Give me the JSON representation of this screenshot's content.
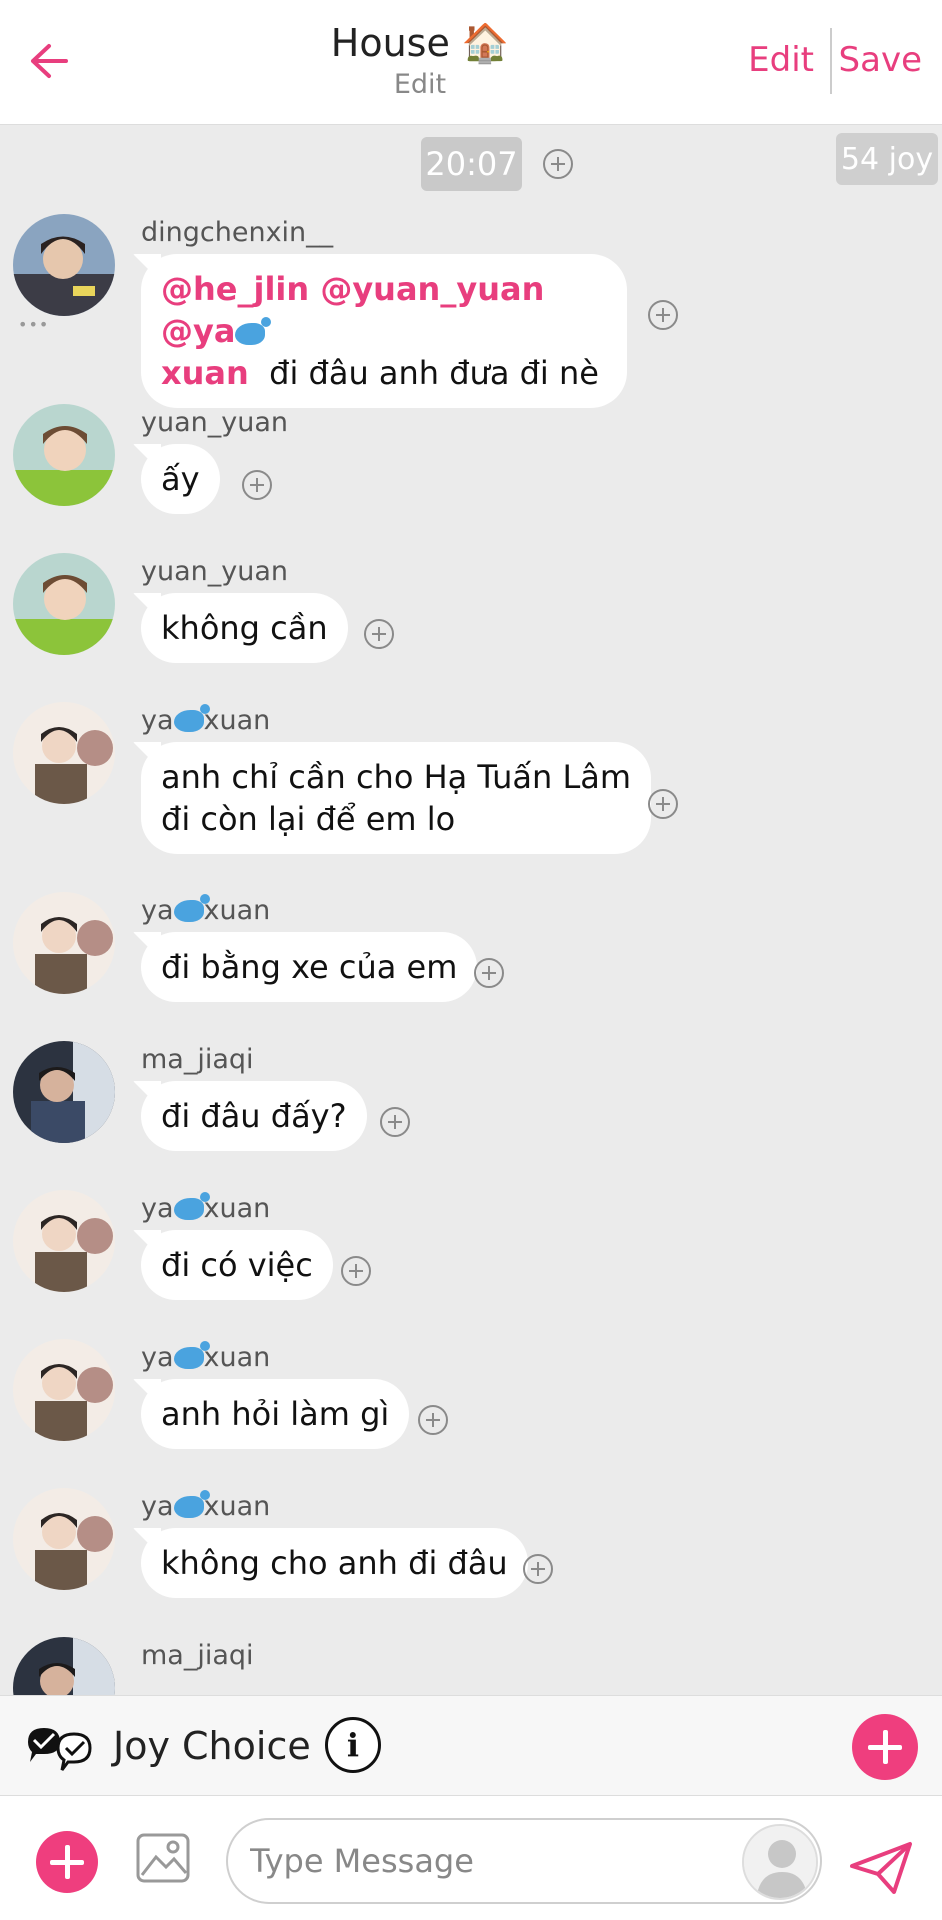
{
  "header": {
    "title": "House 🏠",
    "subtitle": "Edit",
    "edit_label": "Edit",
    "save_label": "Save"
  },
  "time_label": "20:07",
  "joy_badge": "54 joy",
  "messages": [
    {
      "user": "dingchenxin__",
      "mentions": "@he_jlin @yuan_yuan @ya",
      "mentions2": "xuan",
      "text": "đi đâu anh đưa đi nè"
    },
    {
      "user": "yuan_yuan",
      "text": "ấy"
    },
    {
      "user": "yuan_yuan",
      "text": "không cần"
    },
    {
      "user_a": "ya",
      "user_b": "xuan",
      "line1": "anh chỉ cần cho Hạ Tuấn Lâm",
      "line2": "đi còn lại để em lo"
    },
    {
      "user_a": "ya",
      "user_b": "xuan",
      "text": "đi bằng xe của em"
    },
    {
      "user": "ma_jiaqi",
      "text": "đi đâu đấy?"
    },
    {
      "user_a": "ya",
      "user_b": "xuan",
      "text": "đi có việc"
    },
    {
      "user_a": "ya",
      "user_b": "xuan",
      "text": "anh hỏi làm gì"
    },
    {
      "user_a": "ya",
      "user_b": "xuan",
      "text": "không cho anh đi đâu"
    },
    {
      "user": "ma_jiaqi"
    }
  ],
  "joy_choice_label": "Joy Choice",
  "input": {
    "placeholder": "Type Message"
  },
  "colors": {
    "accent": "#e83e7e",
    "background": "#ebebeb"
  },
  "icons": [
    "back-arrow-icon",
    "add-circle-icon",
    "info-icon",
    "image-icon",
    "send-icon",
    "whale-emoji"
  ]
}
